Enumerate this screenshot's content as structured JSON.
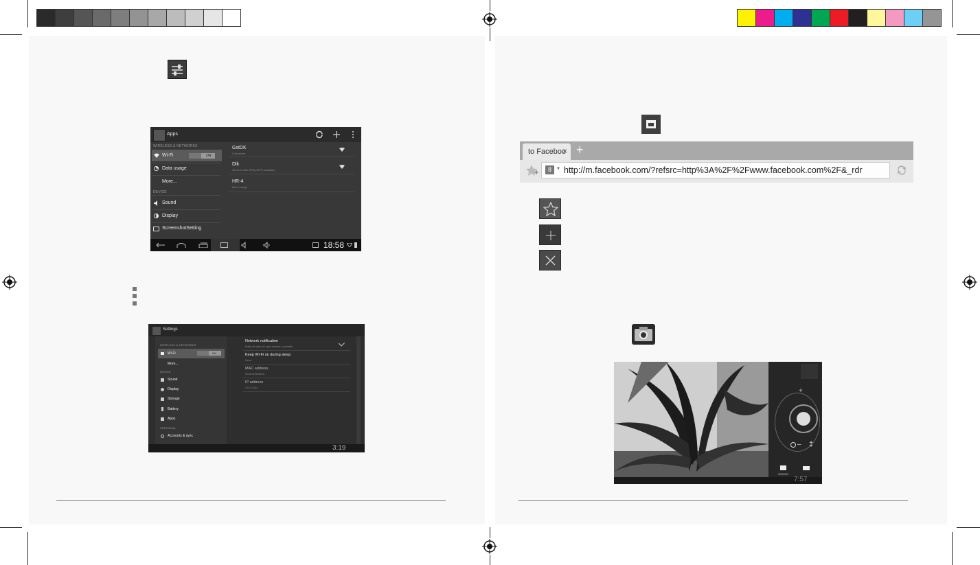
{
  "colors": {
    "grays": [
      "#2a2a2a",
      "#3e3e3e",
      "#555555",
      "#6a6a6a",
      "#7e7e7e",
      "#939393",
      "#a8a8a8",
      "#bcbcbc",
      "#d0d0d0",
      "#e6e6e6",
      "#ffffff"
    ],
    "process": [
      "#fff200",
      "#ec1c8c",
      "#00aeef",
      "#2e3192",
      "#00a651",
      "#ed1c24",
      "#231f20",
      "#fff799",
      "#f49ac1",
      "#6dcff6",
      "#959595"
    ]
  },
  "apps_screen": {
    "title": "Apps",
    "section_wireless": "WIRELESS & NETWORKS",
    "wifi": "Wi-Fi",
    "toggle": "ON",
    "data_usage": "Data usage",
    "more": "More...",
    "section_device": "DEVICE",
    "sound": "Sound",
    "display": "Display",
    "screenshot": "ScreenshotSetting",
    "networks": [
      {
        "name": "GstDK",
        "status": "Connected"
      },
      {
        "name": "Dlk",
        "status": "Secured with WPA (WPS available)"
      },
      {
        "name": "HR-4",
        "status": "Not in range"
      }
    ],
    "time": "18:58"
  },
  "settings_screen": {
    "title": "Settings",
    "section_wireless": "WIRELESS & NETWORKS",
    "wifi": "Wi-Fi",
    "toggle": "ON",
    "more": "More...",
    "section_device": "DEVICE",
    "sound": "Sound",
    "display": "Display",
    "storage": "Storage",
    "battery": "Battery",
    "apps": "Apps",
    "section_personal": "PERSONAL",
    "accounts": "Accounts & sync",
    "rows": [
      {
        "title": "Network notification",
        "sub": "Notify me when an open network is available"
      },
      {
        "title": "Keep Wi-Fi on during sleep",
        "sub": "Never"
      },
      {
        "title": "MAC address",
        "sub": "00:66:13:66:66:00"
      },
      {
        "title": "IP address",
        "sub": "10.0.11.244"
      }
    ],
    "time": "3:19"
  },
  "browser": {
    "tab_label": "to Faceboo",
    "url": "http://m.facebook.com/?refsrc=http%3A%2F%2Fwww.facebook.com%2F&_rdr"
  },
  "camera": {
    "time": "7:57"
  }
}
